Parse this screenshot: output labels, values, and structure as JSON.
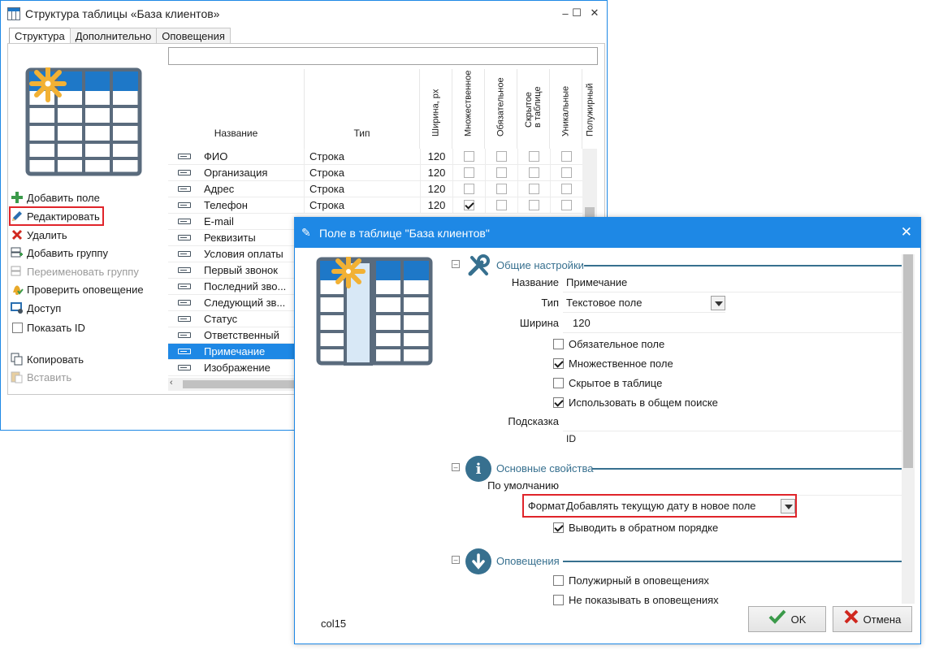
{
  "window1": {
    "title": "Структура таблицы «База клиентов»",
    "controls": {
      "minimize": "–",
      "maximize": "☐",
      "close": "✕"
    },
    "tabs": [
      {
        "label": "Структура"
      },
      {
        "label": "Дополнительно"
      },
      {
        "label": "Оповещения"
      }
    ],
    "search_value": "",
    "actions": [
      {
        "label": "Добавить поле",
        "icon": "plus-icon"
      },
      {
        "label": "Редактировать",
        "icon": "pencil-icon"
      },
      {
        "label": "Удалить",
        "icon": "delete-x-icon"
      },
      {
        "label": "Добавить группу",
        "icon": "add-group-icon"
      },
      {
        "label": "Переименовать группу",
        "icon": "rename-group-icon"
      },
      {
        "label": "Проверить оповещение",
        "icon": "bell-check-icon"
      },
      {
        "label": "Доступ",
        "icon": "access-icon"
      },
      {
        "label": "Показать ID",
        "icon": "checkbox"
      },
      {
        "label": "Копировать",
        "icon": "copy-icon"
      },
      {
        "label": "Вставить",
        "icon": "paste-icon"
      }
    ],
    "columns": {
      "name": "Название",
      "type": "Тип",
      "width": "Ширина, px",
      "multiple": "Множественное",
      "required": "Обязательное",
      "hidden": "Скрытое\nв таблице",
      "unique": "Уникальные",
      "more": "Полужирный"
    },
    "fields": [
      {
        "name": "ФИО",
        "type": "Строка",
        "width": "120",
        "multiple": false
      },
      {
        "name": "Организация",
        "type": "Строка",
        "width": "120",
        "multiple": false
      },
      {
        "name": "Адрес",
        "type": "Строка",
        "width": "120",
        "multiple": false
      },
      {
        "name": "Телефон",
        "type": "Строка",
        "width": "120",
        "multiple": true
      },
      {
        "name": "E-mail"
      },
      {
        "name": "Реквизиты"
      },
      {
        "name": "Условия оплаты"
      },
      {
        "name": "Первый звонок"
      },
      {
        "name": "Последний зво..."
      },
      {
        "name": "Следующий зв..."
      },
      {
        "name": "Статус"
      },
      {
        "name": "Ответственный"
      },
      {
        "name": "Примечание",
        "selected": true
      },
      {
        "name": "Изображение"
      }
    ]
  },
  "window2": {
    "title": "Поле в таблице \"База клиентов\"",
    "close": "✕",
    "sections": {
      "general": "Общие настройки",
      "main": "Основные свойства",
      "alerts": "Оповещения"
    },
    "props": {
      "name_label": "Название",
      "name_value": "Примечание",
      "type_label": "Тип",
      "type_value": "Текстовое поле",
      "width_label": "Ширина",
      "width_value": "120",
      "hint_label": "Подсказка",
      "id_label": "ID",
      "default_label": "По умолчанию",
      "format_label": "Формат",
      "format_value": "Добавлять текущую дату в новое поле"
    },
    "checks": {
      "required": {
        "label": "Обязательное поле",
        "checked": false
      },
      "multiple": {
        "label": "Множественное поле",
        "checked": true
      },
      "hidden": {
        "label": "Скрытое в таблице",
        "checked": false
      },
      "search": {
        "label": "Использовать в общем поиске",
        "checked": true
      },
      "reverse": {
        "label": "Выводить в обратном порядке",
        "checked": true
      },
      "bold_alerts": {
        "label": "Полужирный в оповещениях",
        "checked": false
      },
      "hide_alerts": {
        "label": "Не показывать в оповещениях",
        "checked": false
      }
    },
    "footer_id": "col15",
    "ok_label": "OK",
    "cancel_label": "Отмена"
  },
  "colors": {
    "accent": "#1e88e5",
    "section": "#37708f",
    "highlight": "#e0242a",
    "table_head": "#1e78c8"
  }
}
